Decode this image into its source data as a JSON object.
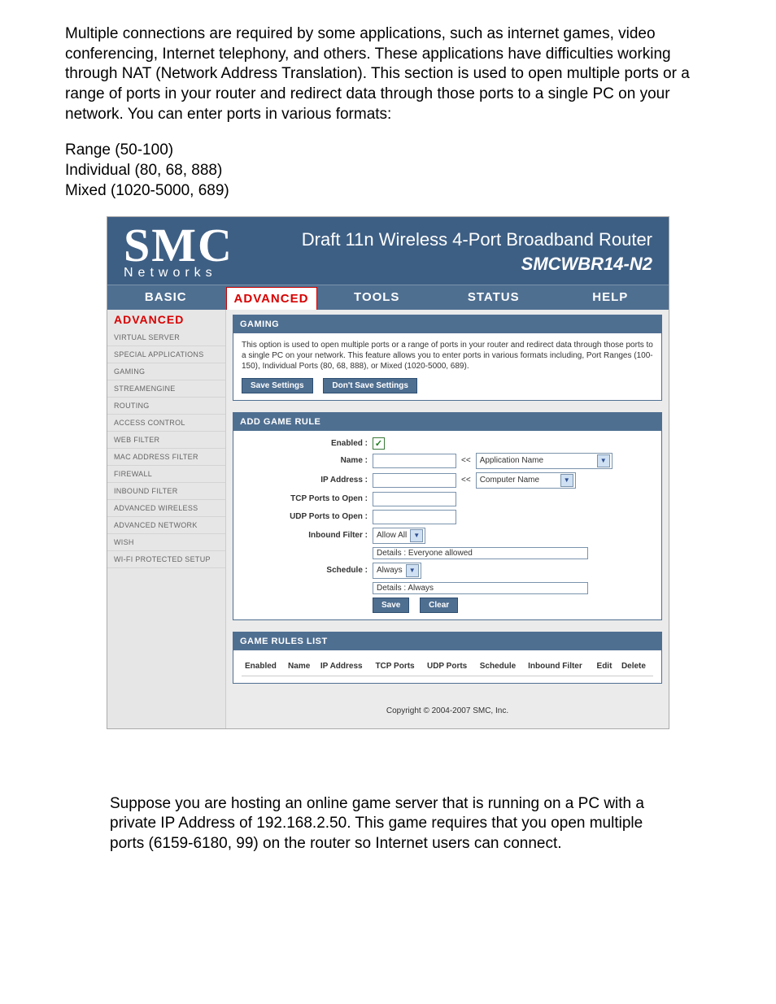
{
  "doc": {
    "intro": "Multiple connections are required by some applications, such as internet games, video conferencing, Internet telephony, and others. These applications have difficulties working through NAT (Network Address Translation). This section is used to open multiple ports or a range of ports in your router and redirect data through those ports to a single PC on your network. You can enter ports in various formats:",
    "range": "Range (50-100)",
    "individual": "Individual (80, 68, 888)",
    "mixed": "Mixed (1020-5000, 689)",
    "outro": "Suppose you are hosting an online game server that is running on a PC with a private IP Address of 192.168.2.50. This game requires that you open multiple ports (6159-6180, 99) on the router so Internet users can connect."
  },
  "header": {
    "brand_big": "SMC",
    "brand_sub": "Networks",
    "title1": "Draft 11n Wireless 4-Port Broadband Router",
    "title2": "SMCWBR14-N2"
  },
  "topnav": {
    "basic": "BASIC",
    "advanced": "ADVANCED",
    "tools": "TOOLS",
    "status": "STATUS",
    "help": "HELP"
  },
  "sidebar": {
    "head": "ADVANCED",
    "items": [
      "VIRTUAL SERVER",
      "SPECIAL APPLICATIONS",
      "GAMING",
      "STREAMENGINE",
      "ROUTING",
      "ACCESS CONTROL",
      "WEB FILTER",
      "MAC ADDRESS FILTER",
      "FIREWALL",
      "INBOUND FILTER",
      "ADVANCED WIRELESS",
      "ADVANCED NETWORK",
      "WISH",
      "WI-FI PROTECTED SETUP"
    ]
  },
  "gaming_panel": {
    "title": "GAMING",
    "desc": "This option is used to open multiple ports or a range of ports in your router and redirect data through those ports to a single PC on your network. This feature allows you to enter ports in various formats including, Port Ranges (100-150), Individual Ports (80, 68, 888), or Mixed (1020-5000, 689).",
    "save": "Save Settings",
    "dont_save": "Don't Save Settings"
  },
  "add_rule": {
    "title": "ADD GAME RULE",
    "enabled_label": "Enabled :",
    "name_label": "Name :",
    "ip_label": "IP Address :",
    "tcp_label": "TCP Ports to Open :",
    "udp_label": "UDP Ports to Open :",
    "inbound_label": "Inbound Filter :",
    "schedule_label": "Schedule :",
    "app_name_select": "Application Name",
    "computer_name_select": "Computer Name",
    "inbound_select": "Allow All",
    "inbound_details_label": "Details :",
    "inbound_details_value": "Everyone allowed",
    "schedule_select": "Always",
    "schedule_details_label": "Details :",
    "schedule_details_value": "Always",
    "save_btn": "Save",
    "clear_btn": "Clear",
    "angles": "<<"
  },
  "rules_list": {
    "title": "GAME RULES LIST",
    "cols": {
      "enabled": "Enabled",
      "name": "Name",
      "ip": "IP Address",
      "tcp": "TCP Ports",
      "udp": "UDP Ports",
      "schedule": "Schedule",
      "inbound": "Inbound Filter",
      "edit": "Edit",
      "delete": "Delete"
    }
  },
  "copyright": "Copyright © 2004-2007 SMC, Inc."
}
